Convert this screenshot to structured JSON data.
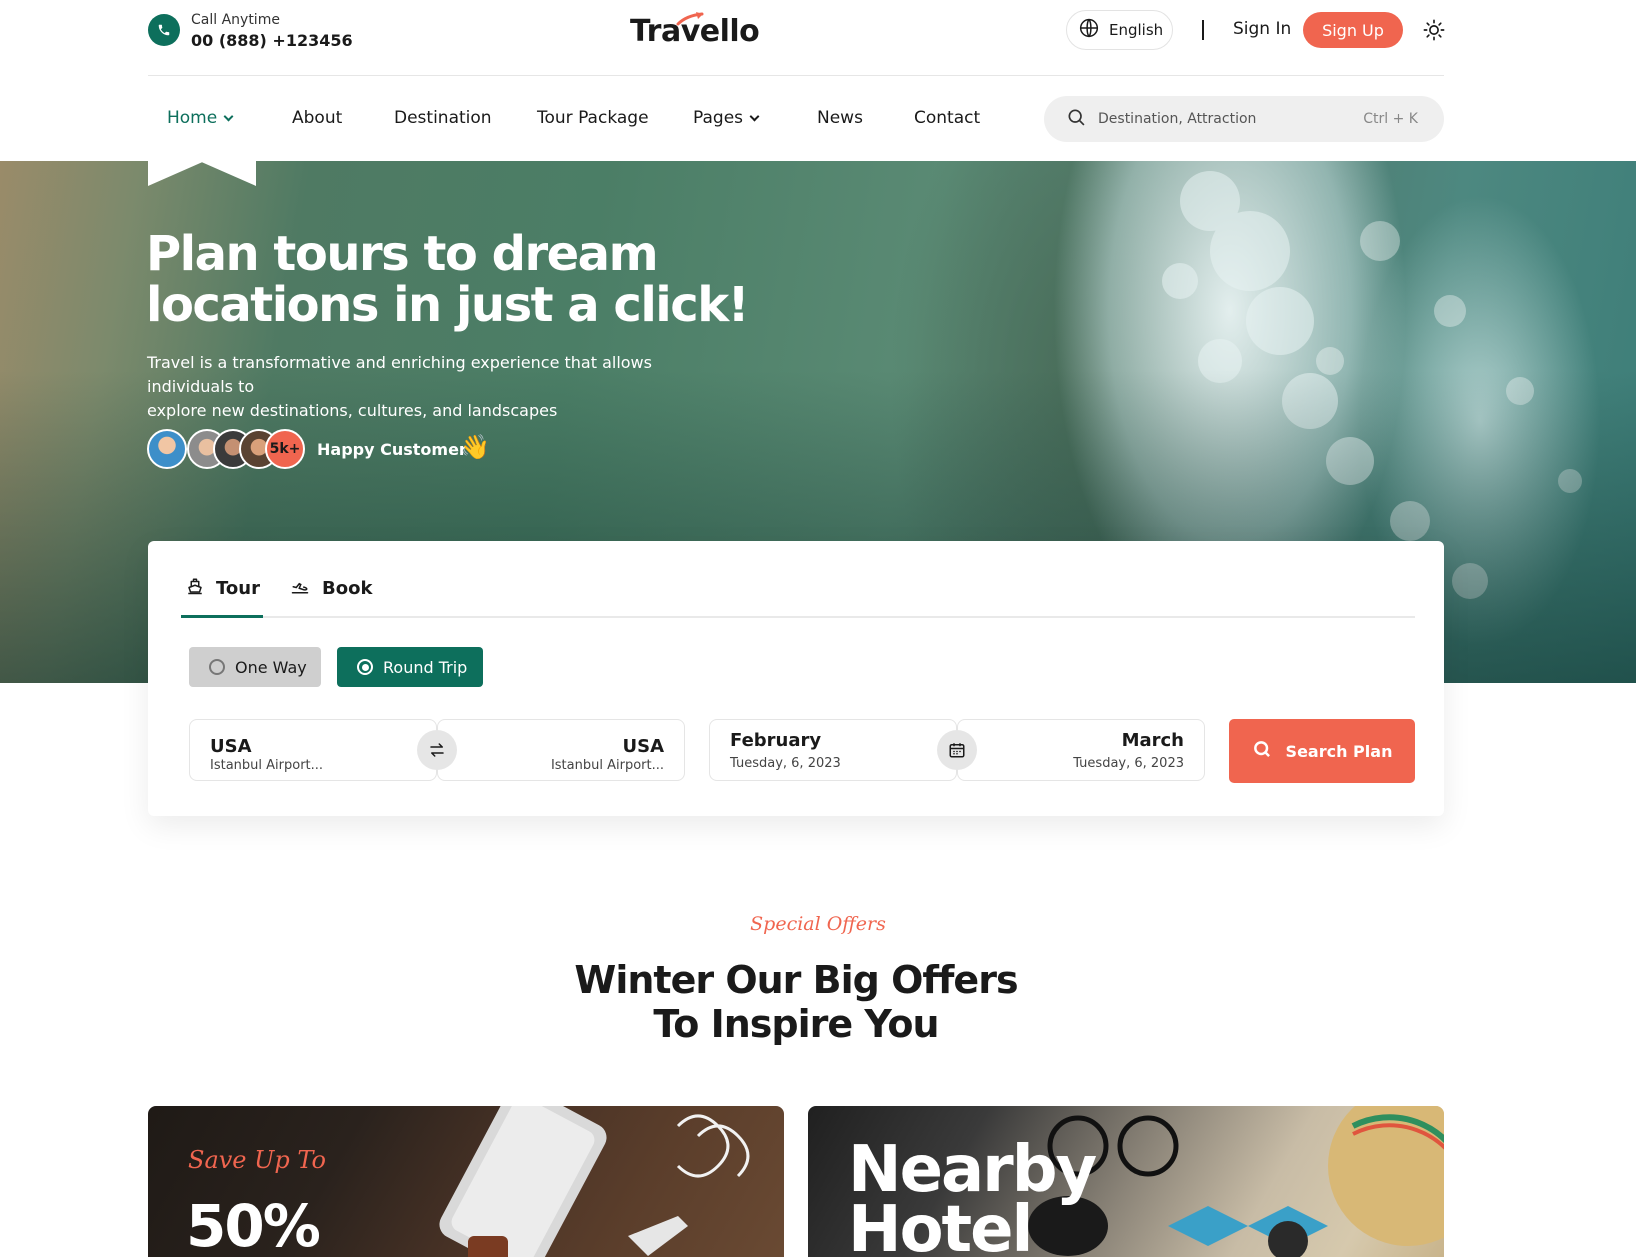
{
  "header": {
    "call_label": "Call Anytime",
    "call_number": "00 (888) +123456",
    "logo": "Travello",
    "language": "English",
    "sign_in": "Sign In",
    "sign_up": "Sign Up"
  },
  "nav": {
    "items": [
      {
        "label": "Home",
        "has_dropdown": true,
        "active": true
      },
      {
        "label": "About"
      },
      {
        "label": "Destination"
      },
      {
        "label": "Tour Package"
      },
      {
        "label": "Pages",
        "has_dropdown": true
      },
      {
        "label": "News"
      },
      {
        "label": "Contact"
      }
    ],
    "search_placeholder": "Destination, Attraction",
    "search_shortcut": "Ctrl + K"
  },
  "hero": {
    "title_line1": "Plan tours to dream",
    "title_line2": "locations in just a click!",
    "subtitle_line1": "Travel is a transformative and enriching experience that allows individuals to",
    "subtitle_line2": "explore new destinations, cultures, and landscapes",
    "customer_count": "5k+",
    "customer_label": "Happy Customer"
  },
  "booking": {
    "tabs": [
      "Tour",
      "Book"
    ],
    "active_tab": "Tour",
    "trip_types": [
      "One Way",
      "Round Trip"
    ],
    "selected_trip": "Round Trip",
    "from": {
      "country": "USA",
      "airport": "Istanbul Airport..."
    },
    "to": {
      "country": "USA",
      "airport": "Istanbul Airport..."
    },
    "depart": {
      "month": "February",
      "date": "Tuesday, 6, 2023"
    },
    "return": {
      "month": "March",
      "date": "Tuesday, 6, 2023"
    },
    "search_button": "Search Plan"
  },
  "offers": {
    "eyebrow": "Special Offers",
    "title_line1": "Winter Our Big Offers",
    "title_line2": "To Inspire You",
    "cards": [
      {
        "eyebrow": "Save Up To",
        "headline": "50%"
      },
      {
        "headline_line1": "Nearby",
        "headline_line2": "Hotel"
      }
    ]
  },
  "colors": {
    "primary": "#0d6f5c",
    "accent": "#f0654f",
    "text": "#1a1a1a"
  },
  "icons": [
    "phone-icon",
    "globe-icon",
    "sun-icon",
    "search-icon",
    "ship-icon",
    "plane-icon",
    "swap-icon",
    "calendar-icon",
    "wave-hand-icon"
  ]
}
